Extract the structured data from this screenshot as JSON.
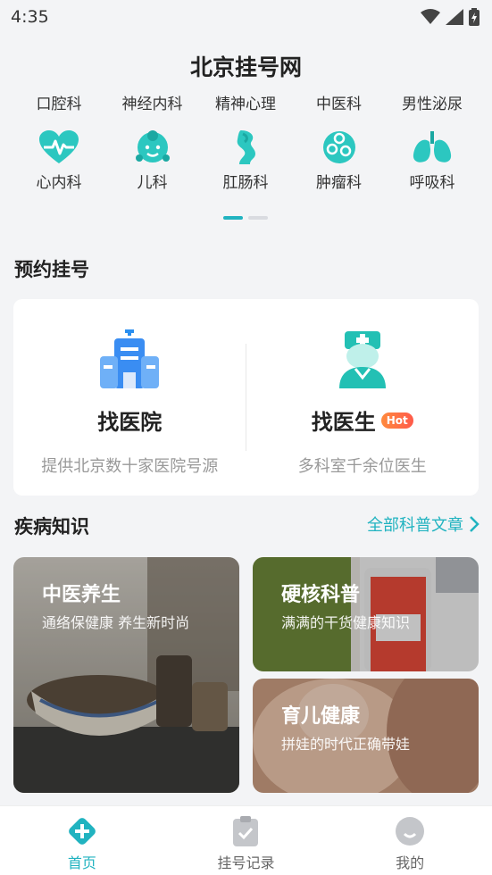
{
  "status_bar": {
    "time": "4:35"
  },
  "app": {
    "title": "北京挂号网"
  },
  "departments": {
    "row1": [
      "口腔科",
      "神经内科",
      "精神心理",
      "中医科",
      "男性泌尿"
    ],
    "row2": [
      {
        "label": "心内科",
        "icon": "heart-icon"
      },
      {
        "label": "儿科",
        "icon": "baby-icon"
      },
      {
        "label": "肛肠科",
        "icon": "intestine-icon"
      },
      {
        "label": "肿瘤科",
        "icon": "cells-icon"
      },
      {
        "label": "呼吸科",
        "icon": "lungs-icon"
      }
    ]
  },
  "booking": {
    "section_title": "预约挂号",
    "hospital": {
      "name": "找医院",
      "desc": "提供北京数十家医院号源"
    },
    "doctor": {
      "name": "找医生",
      "badge": "Hot",
      "desc": "多科室千余位医生"
    }
  },
  "knowledge": {
    "section_title": "疾病知识",
    "all_link": "全部科普文章",
    "tiles": [
      {
        "title": "中医养生",
        "subtitle": "通络保健康 养生新时尚"
      },
      {
        "title": "硬核科普",
        "subtitle": "满满的干货健康知识"
      },
      {
        "title": "育儿健康",
        "subtitle": "拼娃的时代正确带娃"
      }
    ]
  },
  "bottom_nav": {
    "items": [
      {
        "label": "首页",
        "icon": "home-plus-icon",
        "active": true
      },
      {
        "label": "挂号记录",
        "icon": "clipboard-check-icon",
        "active": false
      },
      {
        "label": "我的",
        "icon": "profile-icon",
        "active": false
      }
    ]
  },
  "colors": {
    "accent": "#21b3c0",
    "hot_badge": "#ff6a45",
    "page_bg": "#f3f4f6"
  }
}
